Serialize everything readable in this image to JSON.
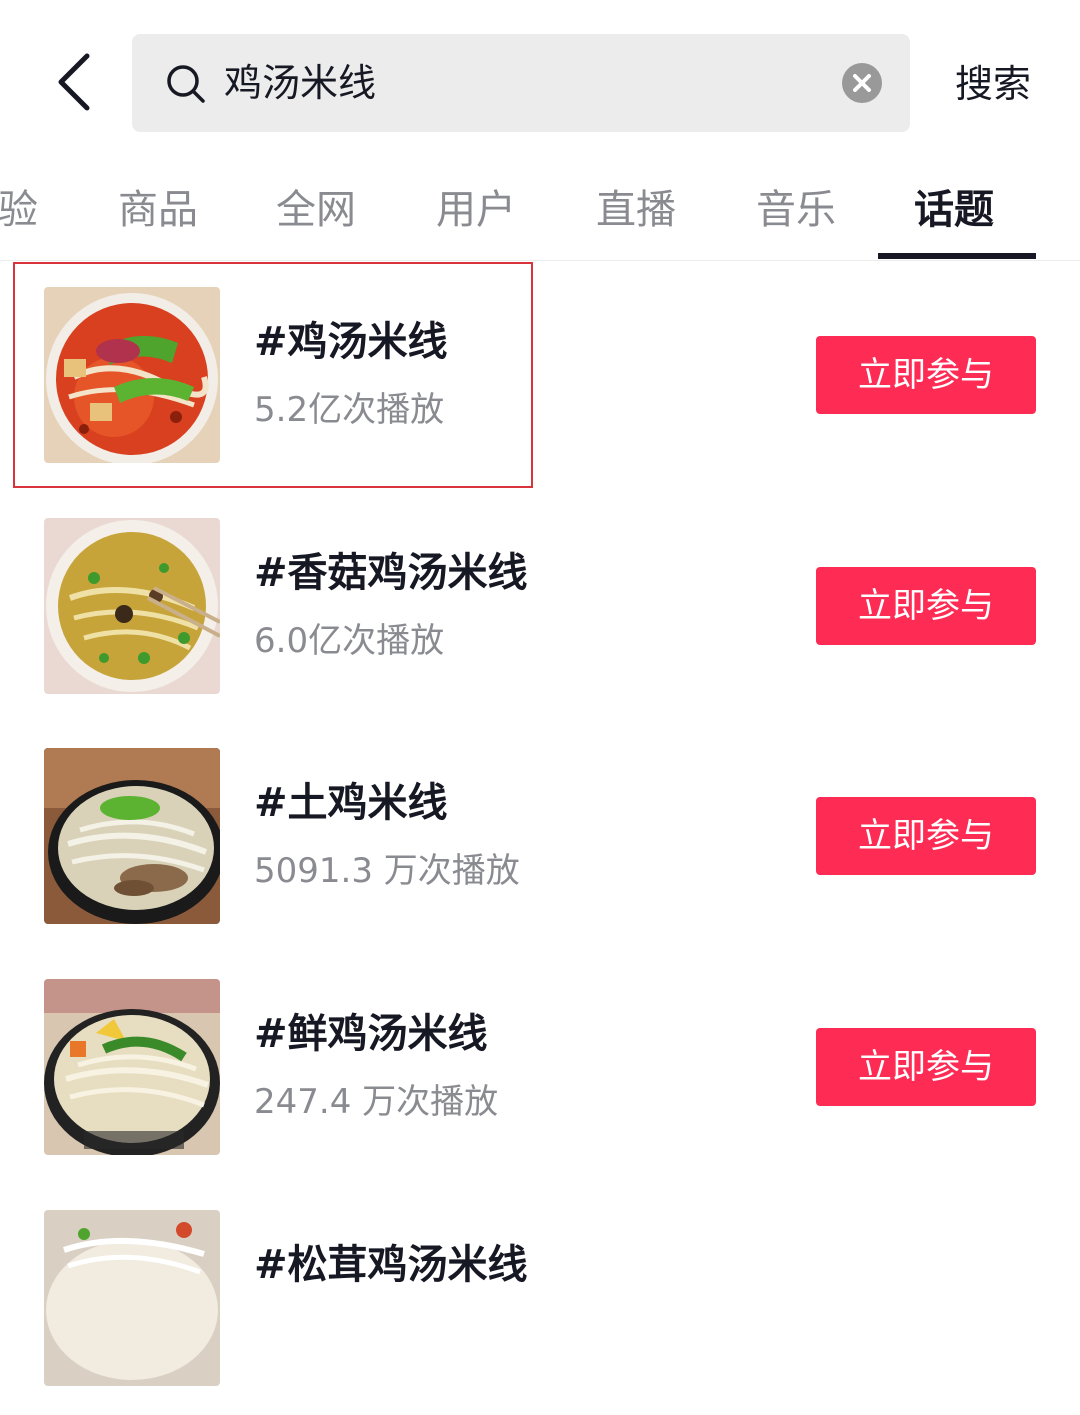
{
  "search": {
    "query": "鸡汤米线",
    "button_label": "搜索"
  },
  "tabs": [
    {
      "label": "验",
      "active": false
    },
    {
      "label": "商品",
      "active": false
    },
    {
      "label": "全网",
      "active": false
    },
    {
      "label": "用户",
      "active": false
    },
    {
      "label": "直播",
      "active": false
    },
    {
      "label": "音乐",
      "active": false
    },
    {
      "label": "话题",
      "active": true
    }
  ],
  "results": [
    {
      "title": "#鸡汤米线",
      "views": "5.2亿次播放",
      "button_label": "立即参与",
      "highlighted": true,
      "thumbnail": "spicy-chicken-noodle-soup-bowl"
    },
    {
      "title": "#香菇鸡汤米线",
      "views": "6.0亿次播放",
      "button_label": "立即参与",
      "highlighted": false,
      "thumbnail": "mushroom-chicken-noodle-soup-bowl"
    },
    {
      "title": "#土鸡米线",
      "views": "5091.3 万次播放",
      "button_label": "立即参与",
      "highlighted": false,
      "thumbnail": "free-range-chicken-noodle-bowl"
    },
    {
      "title": "#鲜鸡汤米线",
      "views": "247.4 万次播放",
      "button_label": "立即参与",
      "highlighted": false,
      "thumbnail": "fresh-chicken-noodle-soup-bowl"
    },
    {
      "title": "#松茸鸡汤米线",
      "views": "",
      "button_label": "",
      "highlighted": false,
      "thumbnail": "matsutake-chicken-noodle-bowl"
    }
  ],
  "colors": {
    "accent": "#fe2c55",
    "highlight_border": "#d9343c",
    "text_primary": "#161823",
    "text_secondary": "#8a8b91",
    "search_bg": "#ececec"
  }
}
